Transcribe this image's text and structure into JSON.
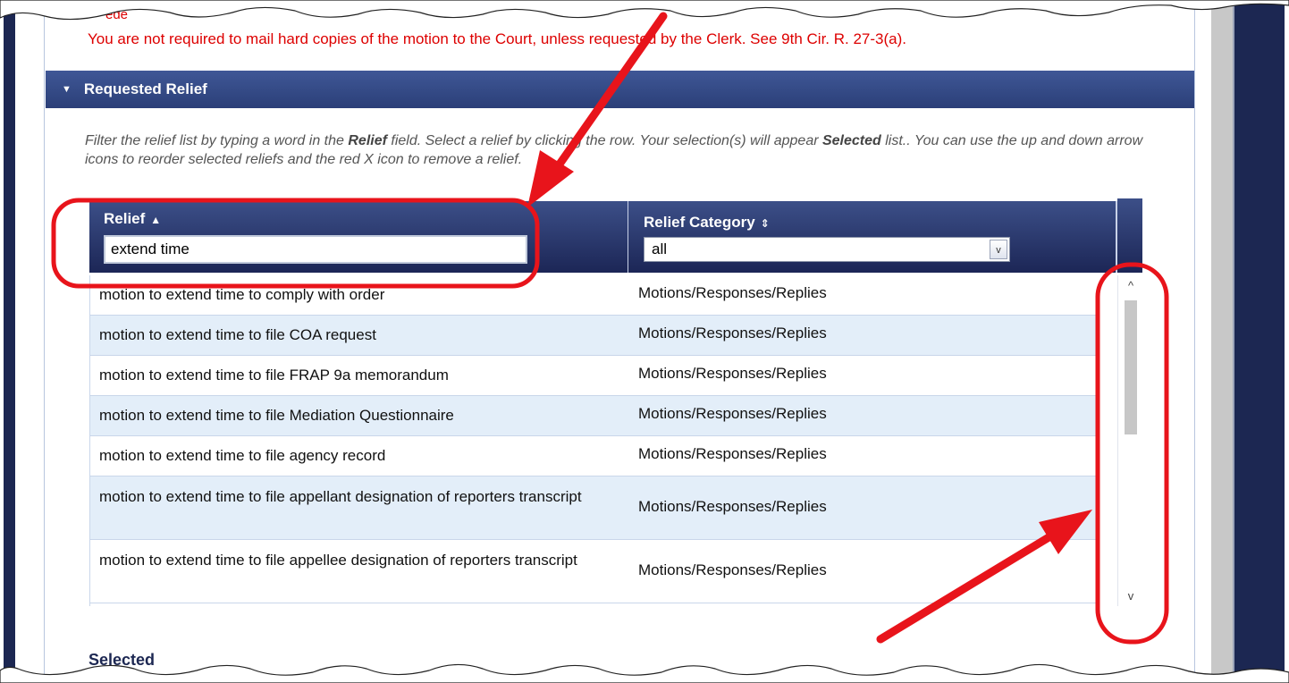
{
  "notice": {
    "fragment": "ede",
    "text": "You are not required to mail hard copies of the motion to the Court, unless requested by the Clerk. See 9th Cir. R. 27-3(a)."
  },
  "section": {
    "caret": "▼",
    "title": "Requested Relief"
  },
  "help": {
    "part1": "Filter the relief list by typing a word in the ",
    "bold1": "Relief",
    "part2": " field. Select a relief by clicking the row. Your selection(s) will appear ",
    "bold2": "Selected",
    "part3": " list.. You can use the up and down arrow icons to reorder selected reliefs and the red X icon to remove a relief."
  },
  "grid": {
    "col1": {
      "label": "Relief",
      "sort_icon": "▲",
      "filter_value": "extend time"
    },
    "col2": {
      "label": "Relief Category",
      "sort_icon": "⇕",
      "filter_value": "all"
    },
    "rows": [
      {
        "relief": "motion to extend time to comply with order",
        "category": "Motions/Responses/Replies"
      },
      {
        "relief": "motion to extend time to file COA request",
        "category": "Motions/Responses/Replies"
      },
      {
        "relief": "motion to extend time to file FRAP 9a memorandum",
        "category": "Motions/Responses/Replies"
      },
      {
        "relief": "motion to extend time to file Mediation Questionnaire",
        "category": "Motions/Responses/Replies"
      },
      {
        "relief": "motion to extend time to file agency record",
        "category": "Motions/Responses/Replies"
      },
      {
        "relief": "motion to extend time to file appellant designation of reporters transcript",
        "category": "Motions/Responses/Replies"
      },
      {
        "relief": "motion to extend time to file appellee designation of reporters transcript",
        "category": "Motions/Responses/Replies"
      }
    ]
  },
  "selected": {
    "label": "Selected"
  },
  "icons": {
    "scroll_up": "^",
    "scroll_down": "v",
    "dropdown": "v"
  },
  "colors": {
    "header_navy": "#2b3f78",
    "alert_red": "#dd0000",
    "row_alt": "#e3eef9",
    "annotation_red": "#e8141b"
  }
}
